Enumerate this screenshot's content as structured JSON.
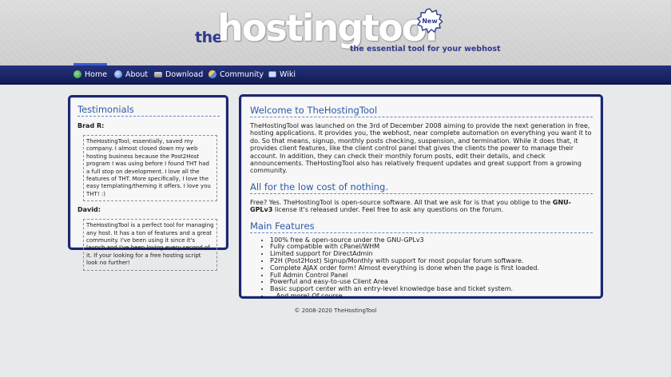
{
  "header": {
    "logo_prefix": "the",
    "logo_main": "hostingtool",
    "logo_badge": "New",
    "tagline": "the essential tool for your webhost"
  },
  "nav": {
    "items": [
      {
        "label": "Home",
        "icon": "home-icon",
        "active": true
      },
      {
        "label": "About",
        "icon": "info-icon",
        "active": false
      },
      {
        "label": "Download",
        "icon": "download-icon",
        "active": false
      },
      {
        "label": "Community",
        "icon": "community-icon",
        "active": false
      },
      {
        "label": "Wiki",
        "icon": "book-icon",
        "active": false
      }
    ]
  },
  "testimonials": {
    "title": "Testimonials",
    "items": [
      {
        "author": "Brad R:",
        "quote": "TheHostingTool; essentially, saved my company. I almost closed down my web hosting business because the Post2Host program I was using before I found THT had a full stop on development. I love all the features of THT. More specifically, I love the easy templating/theming it offers. I love you THT! :)"
      },
      {
        "author": "David:",
        "quote": "TheHostingTool is a perfect tool for managing any host. It has a ton of features and a great community. I've been using it since it's launch and I've been loving every second of it. If your looking for a free hosting script look no further!"
      }
    ]
  },
  "main": {
    "welcome_title": "Welcome to TheHostingTool",
    "welcome_text": "TheHostingTool was launched on the 3rd of December 2008 aiming to provide the next generation in free, hosting applications. It provides you, the webhost, near complete automation on everything you want it to do. So that means, signup, monthly posts checking, suspension, and termination. While it does that, it provides client features, like the client control panel that gives the clients the power to manage their account. In addition, they can check their monthly forum posts, edit their details, and check announcements. TheHostingTool also has relatively frequent updates and great support from a growing community.",
    "cost_title": "All for the low cost of nothing.",
    "cost_text_before": "Free? Yes. TheHostingTool is open-source software. All that we ask for is that you oblige to the ",
    "cost_license": "GNU-GPLv3",
    "cost_text_after": " license it's released under. Feel free to ask any questions on the forum.",
    "features_title": "Main Features",
    "features": [
      "100% free & open-source under the GNU-GPLv3",
      "Fully compatible with cPanel/WHM",
      "Limited support for DirectAdmin",
      "P2H (Post2Host) Signup/Monthly with support for most popular forum software.",
      "Complete AJAX order form! Almost everything is done when the page is first loaded.",
      "Full Admin Control Panel",
      "Powerful and easy-to-use Client Area",
      "Basic support center with an entry-level knowledge base and ticket system.",
      "...And more! Of course."
    ]
  },
  "footer": {
    "copyright": "© 2008-2020 TheHostingTool"
  },
  "colors": {
    "nav_bg": "#1a2566",
    "panel_border": "#1c2670",
    "title_blue": "#2d5aa8",
    "logo_blue": "#2e3a8c"
  }
}
